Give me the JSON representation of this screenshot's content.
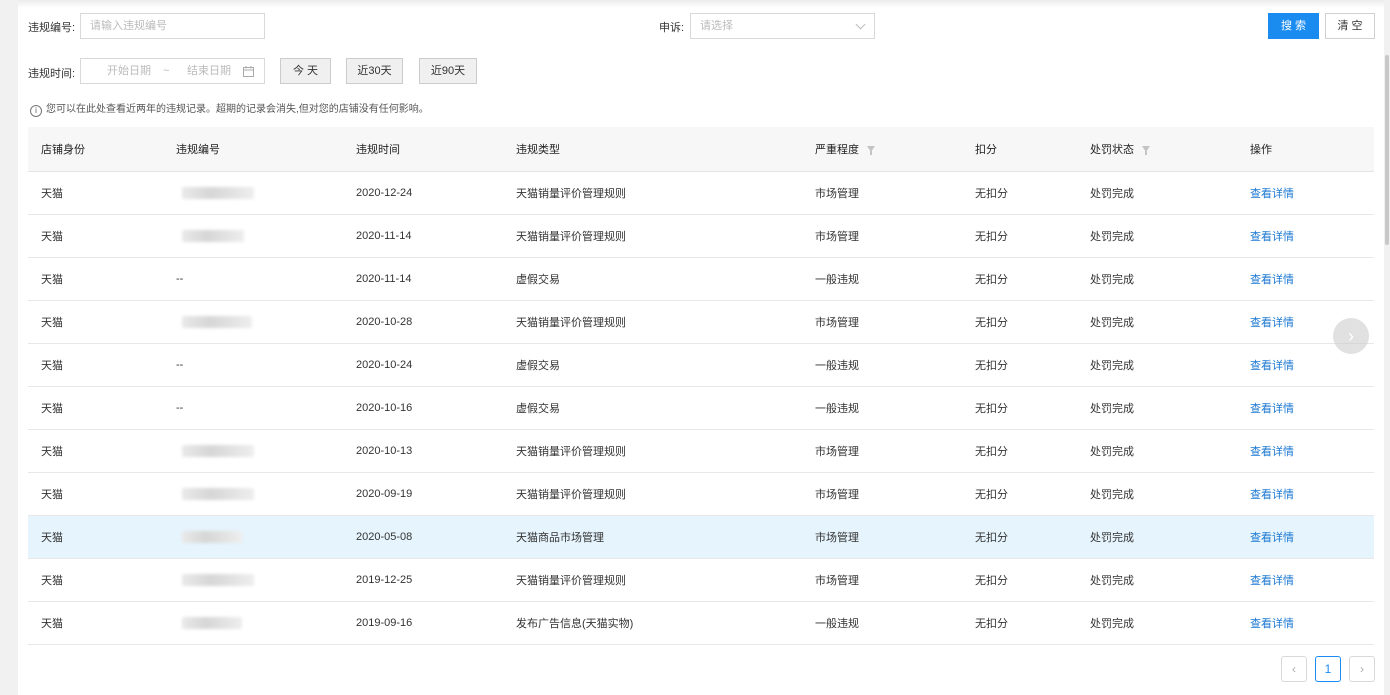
{
  "filters": {
    "violation_no_label": "违规编号:",
    "violation_no_placeholder": "请输入违规编号",
    "appeal_label": "申诉:",
    "appeal_placeholder": "请选择",
    "time_label": "违规时间:",
    "start_placeholder": "开始日期",
    "separator": "~",
    "end_placeholder": "结束日期",
    "today_label": "今 天",
    "last30_label": "近30天",
    "last90_label": "近90天",
    "search_label": "搜 索",
    "clear_label": "清 空"
  },
  "notice": "您可以在此处查看近两年的违规记录。超期的记录会消失,但对您的店铺没有任何影响。",
  "table": {
    "headers": [
      "店铺身份",
      "违规编号",
      "违规时间",
      "违规类型",
      "严重程度",
      "扣分",
      "处罚状态",
      "操作"
    ],
    "rows": [
      {
        "shop": "天猫",
        "no": "",
        "blurred": true,
        "date": "2020-12-24",
        "type": "天猫销量评价管理规则",
        "severity": "市场管理",
        "points": "无扣分",
        "status": "处罚完成",
        "action": "查看详情"
      },
      {
        "shop": "天猫",
        "no": "",
        "blurred": true,
        "date": "2020-11-14",
        "type": "天猫销量评价管理规则",
        "severity": "市场管理",
        "points": "无扣分",
        "status": "处罚完成",
        "action": "查看详情"
      },
      {
        "shop": "天猫",
        "no": "--",
        "blurred": false,
        "date": "2020-11-14",
        "type": "虚假交易",
        "severity": "一般违规",
        "points": "无扣分",
        "status": "处罚完成",
        "action": "查看详情"
      },
      {
        "shop": "天猫",
        "no": "",
        "blurred": true,
        "date": "2020-10-28",
        "type": "天猫销量评价管理规则",
        "severity": "市场管理",
        "points": "无扣分",
        "status": "处罚完成",
        "action": "查看详情"
      },
      {
        "shop": "天猫",
        "no": "--",
        "blurred": false,
        "date": "2020-10-24",
        "type": "虚假交易",
        "severity": "一般违规",
        "points": "无扣分",
        "status": "处罚完成",
        "action": "查看详情"
      },
      {
        "shop": "天猫",
        "no": "--",
        "blurred": false,
        "date": "2020-10-16",
        "type": "虚假交易",
        "severity": "一般违规",
        "points": "无扣分",
        "status": "处罚完成",
        "action": "查看详情"
      },
      {
        "shop": "天猫",
        "no": "",
        "blurred": true,
        "date": "2020-10-13",
        "type": "天猫销量评价管理规则",
        "severity": "市场管理",
        "points": "无扣分",
        "status": "处罚完成",
        "action": "查看详情"
      },
      {
        "shop": "天猫",
        "no": "",
        "blurred": true,
        "date": "2020-09-19",
        "type": "天猫销量评价管理规则",
        "severity": "市场管理",
        "points": "无扣分",
        "status": "处罚完成",
        "action": "查看详情"
      },
      {
        "shop": "天猫",
        "no": "",
        "blurred": true,
        "date": "2020-05-08",
        "type": "天猫商品市场管理",
        "severity": "市场管理",
        "points": "无扣分",
        "status": "处罚完成",
        "action": "查看详情",
        "selected": true
      },
      {
        "shop": "天猫",
        "no": "",
        "blurred": true,
        "date": "2019-12-25",
        "type": "天猫销量评价管理规则",
        "severity": "市场管理",
        "points": "无扣分",
        "status": "处罚完成",
        "action": "查看详情"
      },
      {
        "shop": "天猫",
        "no": "",
        "blurred": true,
        "date": "2019-09-16",
        "type": "发布广告信息(天猫实物)",
        "severity": "一般违规",
        "points": "无扣分",
        "status": "处罚完成",
        "action": "查看详情"
      }
    ]
  },
  "pagination": {
    "prev_icon": "chevron-left-icon",
    "current_page": "1",
    "next_icon": "chevron-right-icon"
  },
  "colors": {
    "primary": "#1a8cf0",
    "link": "#1a77d2",
    "selected_row": "#e6f4fd"
  }
}
